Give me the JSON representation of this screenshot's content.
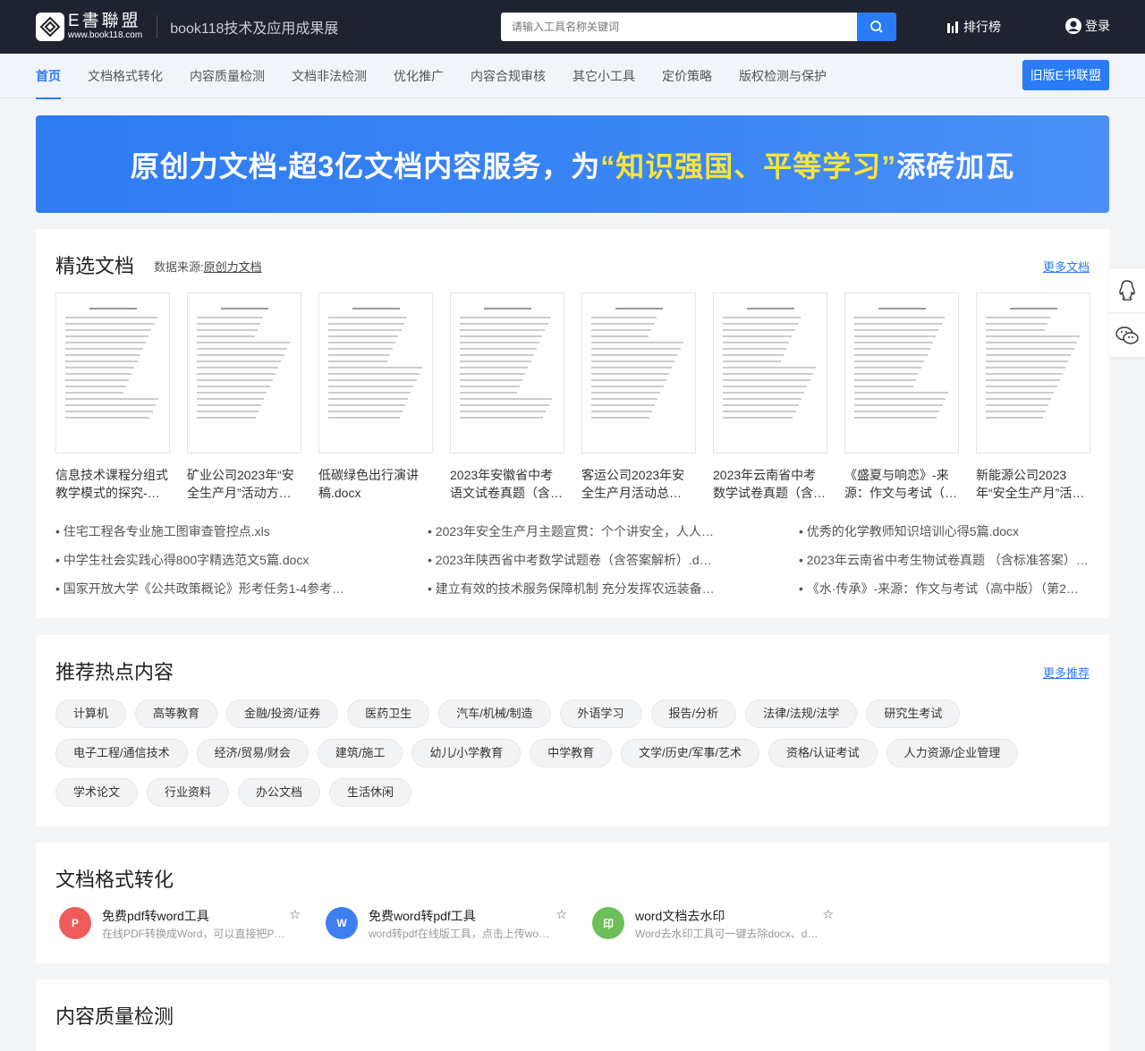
{
  "header": {
    "logo_cn": "E書聯盟",
    "logo_url": "www.book118.com",
    "site_title": "book118技术及应用成果展",
    "search_placeholder": "请输入工具名称关键词",
    "rank_label": "排行榜",
    "login_label": "登录"
  },
  "nav": {
    "items": [
      "首页",
      "文档格式转化",
      "内容质量检测",
      "文档非法检测",
      "优化推广",
      "内容合规审核",
      "其它小工具",
      "定价策略",
      "版权检测与保护"
    ],
    "old_button": "旧版E书联盟"
  },
  "banner": {
    "part1": "原创力文档-超3亿文档内容服务，为",
    "highlight": "“知识强国、平等学习”",
    "part2": "添砖加瓦"
  },
  "featured": {
    "title": "精选文档",
    "source_label": "数据来源:",
    "source_link": "原创力文档",
    "more": "更多文档",
    "docs": [
      "信息技术课程分组式教学模式的探究-…",
      "矿业公司2023年“安全生产月”活动方…",
      "低碳绿色出行演讲稿.docx",
      "2023年安徽省中考语文试卷真题（含…",
      "客运公司2023年安全生产月活动总…",
      "2023年云南省中考数学试卷真题（含…",
      "《盛夏与响恋》-来源：作文与考试（…",
      "新能源公司2023年“安全生产月”活动…"
    ],
    "links": [
      "住宅工程各专业施工图审查管控点.xls",
      "2023年安全生产月主题宣贯：个个讲安全，人人…",
      "优秀的化学教师知识培训心得5篇.docx",
      "中学生社会实践心得800字精选范文5篇.docx",
      "2023年陕西省中考数学试题卷（含答案解析）.d…",
      "2023年云南省中考生物试卷真题 （含标准答案）…",
      "国家开放大学《公共政策概论》形考任务1-4参考…",
      "建立有效的技术服务保障机制 充分发挥农远装备…",
      "《水·传承》-来源：作文与考试（高中版）（第2…"
    ]
  },
  "hot": {
    "title": "推荐热点内容",
    "more": "更多推荐",
    "tags": [
      "计算机",
      "高等教育",
      "金融/投资/证券",
      "医药卫生",
      "汽车/机械/制造",
      "外语学习",
      "报告/分析",
      "法律/法规/法学",
      "研究生考试",
      "电子工程/通信技术",
      "经济/贸易/财会",
      "建筑/施工",
      "幼儿/小学教育",
      "中学教育",
      "文学/历史/军事/艺术",
      "资格/认证考试",
      "人力资源/企业管理",
      "学术论文",
      "行业资料",
      "办公文档",
      "生活休闲"
    ]
  },
  "convert": {
    "title": "文档格式转化",
    "tools": [
      {
        "name": "免费pdf转word工具",
        "desc": "在线PDF转换成Word，可以直接把P…",
        "icon": "P",
        "color": "#ef5b5b"
      },
      {
        "name": "免费word转pdf工具",
        "desc": "word转pdf在线版工具，点击上传wo…",
        "icon": "W",
        "color": "#3d7ff0"
      },
      {
        "name": "word文档去水印",
        "desc": "Word去水印工具可一键去除docx、d…",
        "icon": "印",
        "color": "#6dbf5a"
      }
    ]
  },
  "quality": {
    "title": "内容质量检测"
  }
}
